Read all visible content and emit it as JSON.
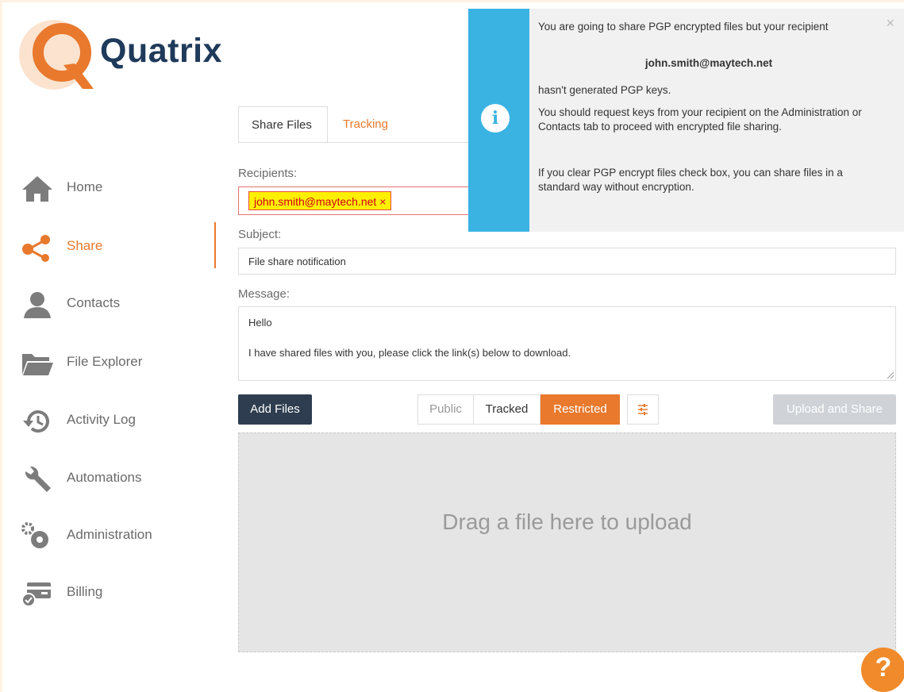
{
  "app": {
    "brand": "Quatrix"
  },
  "sidebar": {
    "items": [
      {
        "label": "Home",
        "icon": "home-icon"
      },
      {
        "label": "Share",
        "icon": "share-icon",
        "active": true
      },
      {
        "label": "Contacts",
        "icon": "contacts-icon"
      },
      {
        "label": "File Explorer",
        "icon": "folder-icon"
      },
      {
        "label": "Activity Log",
        "icon": "history-icon"
      },
      {
        "label": "Automations",
        "icon": "wrench-icon"
      },
      {
        "label": "Administration",
        "icon": "gears-icon"
      },
      {
        "label": "Billing",
        "icon": "billing-icon"
      }
    ]
  },
  "tabs": [
    {
      "label": "Share Files",
      "active": true
    },
    {
      "label": "Tracking",
      "active": false
    }
  ],
  "form": {
    "recipients_label": "Recipients:",
    "recipient_chip": "john.smith@maytech.net",
    "chip_remove": "×",
    "subject_label": "Subject:",
    "subject_value": "File share notification",
    "message_label": "Message:",
    "message_line1": "Hello",
    "message_line2": "I have shared files with you, please click the link(s) below to download."
  },
  "toolbar": {
    "add_files": "Add Files",
    "access_options": [
      "Public",
      "Tracked",
      "Restricted"
    ],
    "selected_access": "Restricted",
    "upload_share": "Upload and Share"
  },
  "dropzone": {
    "text": "Drag a file here to upload"
  },
  "notification": {
    "icon_glyph": "i",
    "close": "×",
    "line1": "You are going to share PGP encrypted files but your recipient",
    "email": "john.smith@maytech.net",
    "line2": "hasn't generated PGP keys.",
    "line3": "You should request keys from your recipient on the Administration or Contacts tab to proceed with encrypted file sharing.",
    "line4": "If you clear PGP encrypt files check box, you can share files in a standard way without encryption."
  },
  "help": {
    "glyph": "?"
  },
  "colors": {
    "accent": "#e8792d",
    "navy": "#2e3e50",
    "info_blue": "#3ab3e3",
    "chip_yellow": "#ffef00",
    "error_red": "#e57373"
  }
}
